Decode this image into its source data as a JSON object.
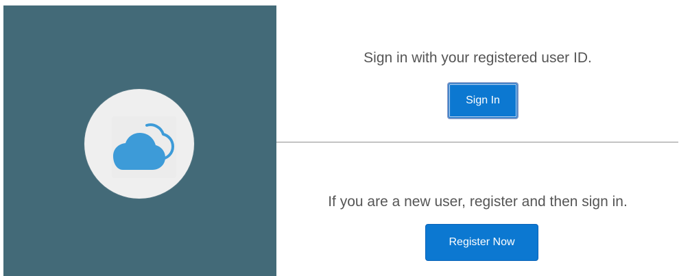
{
  "colors": {
    "left_panel": "#436A78",
    "button": "#0C78D1",
    "cloud": "#3D9BD8"
  },
  "branding": {
    "logo_icon": "cloud-icon"
  },
  "signin": {
    "message": "Sign in with your registered user ID.",
    "button_label": "Sign In"
  },
  "register": {
    "message": "If you are a new user, register and then sign in.",
    "button_label": "Register Now"
  }
}
